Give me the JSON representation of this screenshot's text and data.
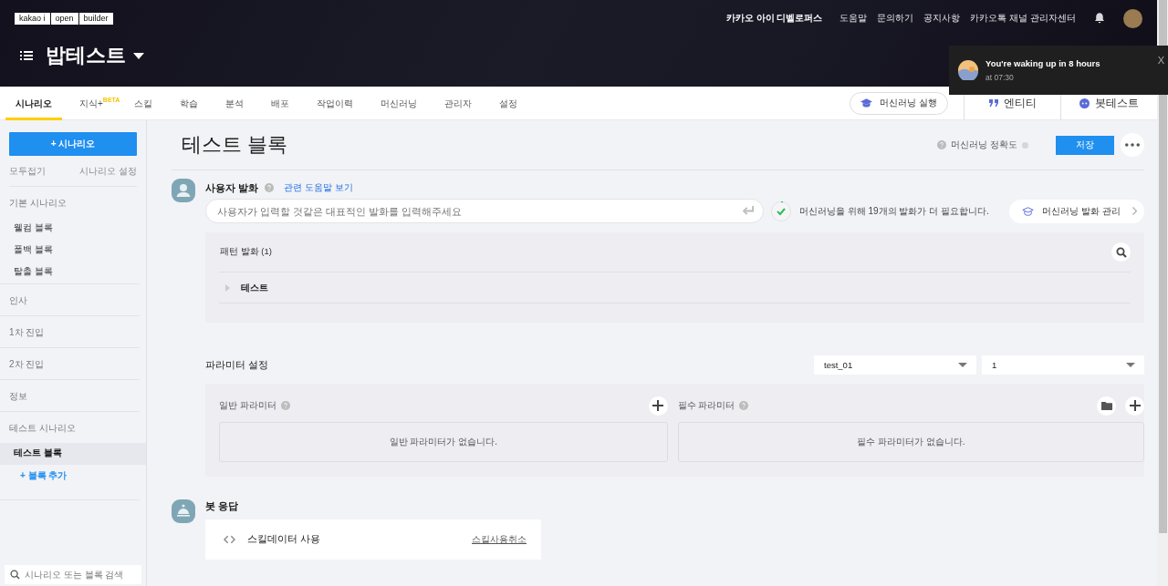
{
  "header": {
    "logo": [
      "kakao i",
      "open",
      "builder"
    ],
    "links": [
      {
        "label": "카카오 아이 디벨로퍼스",
        "strong": true
      },
      {
        "label": "도움말",
        "strong": false
      },
      {
        "label": "문의하기",
        "strong": false
      },
      {
        "label": "공지사항",
        "strong": false
      },
      {
        "label": "카카오톡 채널 관리자센터",
        "strong": false
      }
    ],
    "bot_name": "밥테스트"
  },
  "tabs": [
    {
      "label": "시나리오",
      "selected": true
    },
    {
      "label": "지식+",
      "badge": "BETA",
      "selected": false
    },
    {
      "label": "스킬",
      "selected": false
    },
    {
      "label": "학습",
      "selected": false
    },
    {
      "label": "분석",
      "selected": false
    },
    {
      "label": "배포",
      "selected": false
    },
    {
      "label": "작업이력",
      "selected": false
    },
    {
      "label": "머신러닝",
      "selected": false
    },
    {
      "label": "관리자",
      "selected": false
    },
    {
      "label": "설정",
      "selected": false
    }
  ],
  "tab_actions": {
    "ml_run": "머신러닝 실행",
    "entity": "엔티티",
    "bot_test": "봇테스트"
  },
  "notification": {
    "title": "You're waking up in 8 hours",
    "subtitle": "at 07:30",
    "close": "X"
  },
  "sidebar": {
    "add_button": "+ 시나리오",
    "collapse_all": "모두접기",
    "scenario_settings": "시나리오 설정",
    "groups": [
      {
        "label": "기본 시나리오",
        "items": [
          {
            "label": "웰컴 블록",
            "selected": false
          },
          {
            "label": "폴백 블록",
            "selected": false
          },
          {
            "label": "탈출 블록",
            "selected": false
          }
        ]
      },
      {
        "label": "인사"
      },
      {
        "label": "1차 진입"
      },
      {
        "label": "2차 진입"
      },
      {
        "label": "정보"
      },
      {
        "label": "테스트 시나리오",
        "items": [
          {
            "label": "테스트 블록",
            "selected": true
          }
        ],
        "add_block": "+ 블록 추가"
      }
    ],
    "search": {
      "placeholder": "시나리오 또는 블록 검색"
    }
  },
  "block": {
    "title": "테스트 블록",
    "accuracy_label": "머신러닝 정확도",
    "save": "저장",
    "user_utterance": {
      "heading": "사용자 발화",
      "help_link": "관련 도움말 보기",
      "placeholder": "사용자가 입력할 것같은 대표적인 발화를 입력해주세요",
      "ml_notice": "머신러닝을 위해 19개의 발화가 더 필요합니다.",
      "ml_manage": "머신러닝 발화 관리",
      "patterns_heading": "패턴 발화 (1)",
      "patterns": [
        {
          "text": "테스트",
          "expanded": false
        }
      ]
    },
    "parameters": {
      "heading": "파라미터 설정",
      "selects": [
        "test_01",
        "1"
      ],
      "general": {
        "label": "일반 파라미터",
        "empty": "일반 파라미터가 없습니다."
      },
      "required": {
        "label": "필수 파라미터",
        "empty": "필수 파라미터가 없습니다."
      }
    },
    "bot_response": {
      "heading": "봇 응답",
      "skill_label": "스킬데이터 사용",
      "cancel_link": "스킬사용취소"
    }
  }
}
